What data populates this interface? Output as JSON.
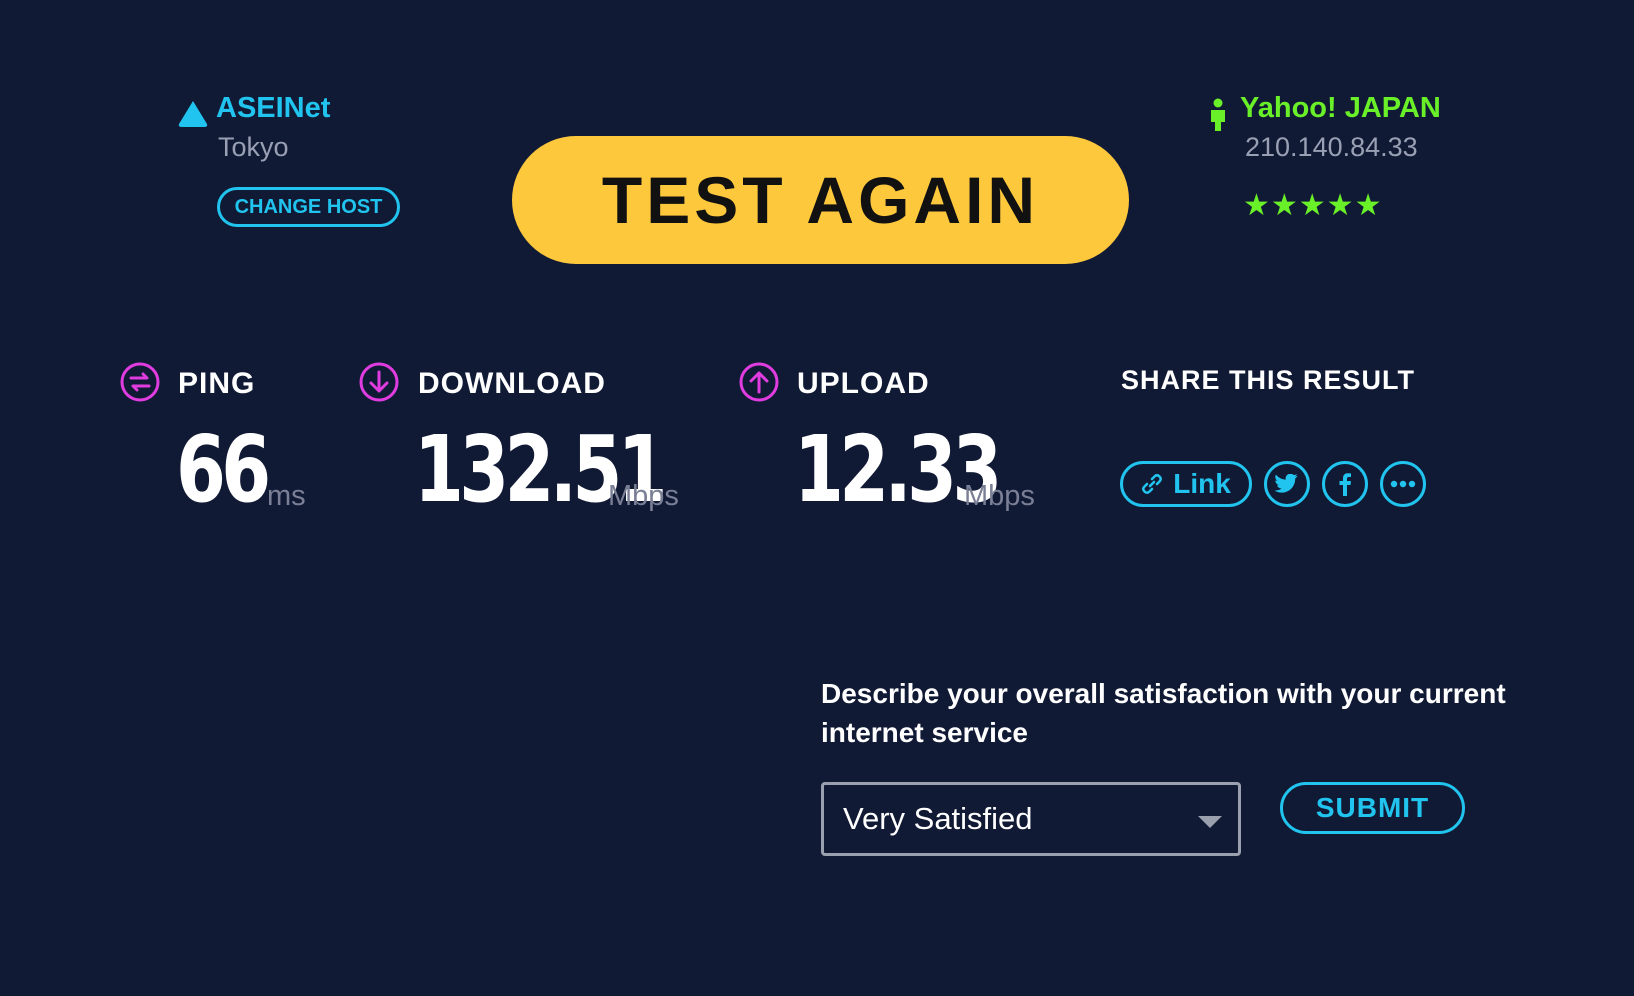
{
  "host": {
    "name": "ASEINet",
    "city": "Tokyo",
    "change_label": "CHANGE HOST",
    "icon": "triangle-server-icon"
  },
  "test_again_label": "TEST AGAIN",
  "isp": {
    "name": "Yahoo! JAPAN",
    "ip": "210.140.84.33",
    "rating_text": "★★★★★",
    "rating": 5,
    "icon": "person-icon"
  },
  "metrics": {
    "ping": {
      "label": "PING",
      "value": "66",
      "unit": "ms",
      "icon": "ping-icon"
    },
    "download": {
      "label": "DOWNLOAD",
      "value": "132.51",
      "unit": "Mbps",
      "icon": "download-arrow-icon"
    },
    "upload": {
      "label": "UPLOAD",
      "value": "12.33",
      "unit": "Mbps",
      "icon": "upload-arrow-icon"
    }
  },
  "share": {
    "title": "SHARE THIS RESULT",
    "link_label": "Link",
    "buttons": [
      "link-icon",
      "twitter-icon",
      "facebook-icon",
      "more-icon"
    ]
  },
  "survey": {
    "question": "Describe your overall satisfaction with your current internet service",
    "selected": "Very Satisfied",
    "submit_label": "SUBMIT"
  },
  "colors": {
    "background": "#111a35",
    "accent_cyan": "#21c4ee",
    "accent_green": "#69f028",
    "accent_purple": "#e03ce0",
    "button_yellow": "#fec83d"
  }
}
